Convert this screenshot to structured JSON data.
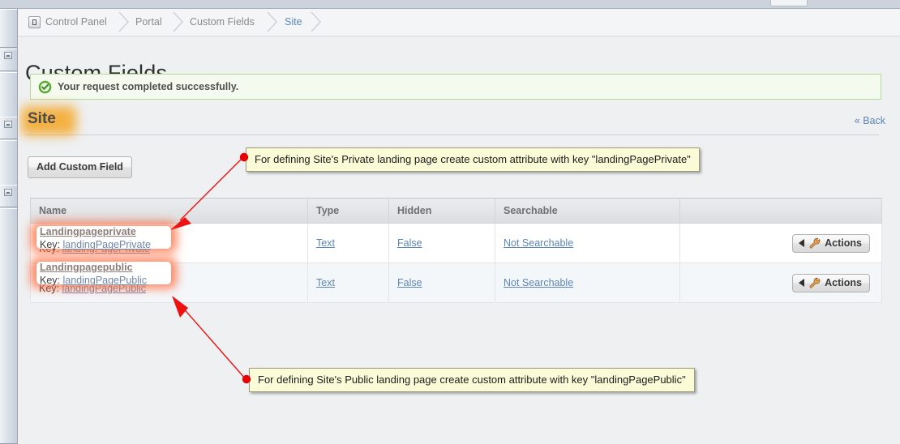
{
  "window": {
    "top_bar_color": "#ccd3dc"
  },
  "sidebar": {
    "segments": [
      "panel-1",
      "panel-2",
      "panel-3",
      "panel-4"
    ]
  },
  "breadcrumb": {
    "items": [
      {
        "label": "Control Panel",
        "active": false,
        "has_icon": true
      },
      {
        "label": "Portal",
        "active": false,
        "has_icon": false
      },
      {
        "label": "Custom Fields",
        "active": false,
        "has_icon": false
      },
      {
        "label": "Site",
        "active": true,
        "has_icon": false
      }
    ]
  },
  "page": {
    "title": "Custom Fields",
    "success_message": "Your request completed successfully.",
    "success_icon": "check-circle-icon",
    "section_heading": "Site",
    "back_link": "« Back",
    "add_button": "Add Custom Field"
  },
  "table": {
    "columns": [
      "Name",
      "Type",
      "Hidden",
      "Searchable",
      ""
    ],
    "rows": [
      {
        "name": "Landingpageprivate",
        "key_label": "Key:",
        "key_value": "landingPagePrivate",
        "type": "Text",
        "hidden": "False",
        "searchable": "Not Searchable",
        "actions_label": "Actions",
        "actions_icon": "wrench-icon",
        "highlighted": true
      },
      {
        "name": "Landingpagepublic",
        "key_label": "Key:",
        "key_value": "landingPagePublic",
        "type": "Text",
        "hidden": "False",
        "searchable": "Not Searchable",
        "actions_label": "Actions",
        "actions_icon": "wrench-icon",
        "highlighted": true
      }
    ]
  },
  "annotations": {
    "callouts": [
      {
        "id": "private",
        "text": "For defining Site's Private landing page create custom attribute with key \"landingPagePrivate\""
      },
      {
        "id": "public",
        "text": "For defining Site's Public landing page create custom attribute with key \"landingPagePublic\""
      }
    ],
    "arrow_color": "#ee1111",
    "highlight_color": "#ff6a3c",
    "heading_highlight_color": "#f5a623"
  }
}
